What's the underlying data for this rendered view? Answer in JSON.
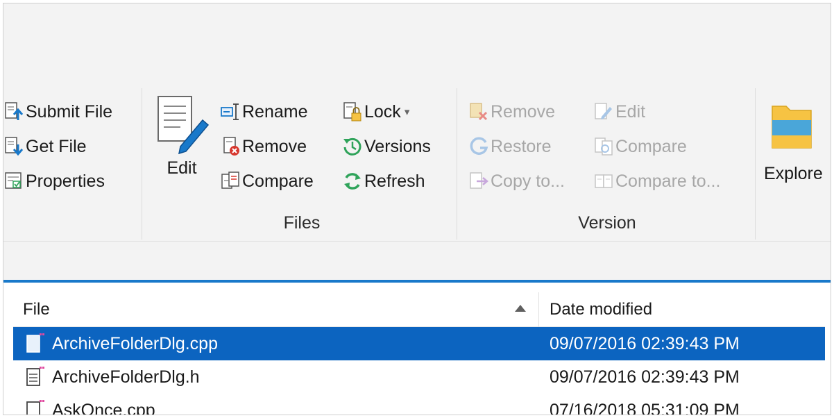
{
  "ribbon": {
    "left_group": {
      "submit_file": "Submit File",
      "get_file": "Get File",
      "properties": "Properties"
    },
    "files_group": {
      "label": "Files",
      "edit_big": "Edit",
      "rename": "Rename",
      "remove": "Remove",
      "compare": "Compare",
      "lock": "Lock",
      "lock_dropdown": "▾",
      "versions": "Versions",
      "refresh": "Refresh"
    },
    "version_group": {
      "label": "Version",
      "remove": "Remove",
      "restore": "Restore",
      "copy_to": "Copy to...",
      "edit": "Edit",
      "compare": "Compare",
      "compare_to": "Compare to..."
    },
    "explore": {
      "label": "Explore"
    }
  },
  "file_list": {
    "columns": {
      "file": "File",
      "date_modified": "Date modified"
    },
    "sort": "ascending",
    "rows": [
      {
        "name": "ArchiveFolderDlg.cpp",
        "date": "09/07/2016 02:39:43 PM",
        "selected": true,
        "icon": "cpp-file-icon"
      },
      {
        "name": "ArchiveFolderDlg.h",
        "date": "09/07/2016 02:39:43 PM",
        "selected": false,
        "icon": "header-file-icon"
      },
      {
        "name": "AskOnce.cpp",
        "date": "07/16/2018 05:31:09 PM",
        "selected": false,
        "icon": "cpp-file-icon"
      }
    ]
  },
  "colors": {
    "accent": "#1979ca",
    "selection": "#0c64c0",
    "ribbon_bg": "#f3f3f3",
    "disabled_text": "#a7a7a7",
    "green_icon": "#2fa35a",
    "red_icon": "#d7382f",
    "folder_yellow": "#f6c343"
  }
}
